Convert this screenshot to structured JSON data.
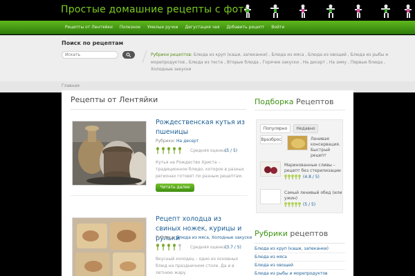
{
  "header": {
    "site_title": "Простые домашние рецепты с фото"
  },
  "nav": {
    "items": [
      "Рецепты от Лентяйки",
      "Полезное",
      "Умелые ручки",
      "Дегустация чая",
      "Добавить рецепт",
      "Войти"
    ]
  },
  "search": {
    "title": "Поиск по рецептам",
    "placeholder": "Искать",
    "button_icon": "search-icon"
  },
  "rubrics_strip": {
    "label": "Рубрики рецептов:",
    "text": " Блюда из круп (каши, запеканки) , Блюда из мяса , Блюда из овощей , Блюда из рыбы и морепродуктов , Блюда из теста , Вторые блюда , Горячие закуски , На десерт , На зиму , Первые блюда , Холодные закуски"
  },
  "breadcrumb": {
    "home": "Главная"
  },
  "main": {
    "title": "Рецепты от Лентяйки",
    "posts": [
      {
        "title": "Рождественская кутья из пшеницы",
        "category_label": "Рубрики:",
        "category": "На десерт",
        "rating_label": "Средняя оценка:",
        "rating_value": "(5 / 5)",
        "rating": 5,
        "excerpt": "Кутья на Рождество Христа – традиционное блюдо, которое в разных регионах готовят по разным рецептам. ...",
        "read_more": "Читать далее"
      },
      {
        "title": "Рецепт холодца из свиных ножек, курицы и рульки",
        "category_label": "Рубрики:",
        "category": "Блюда из мяса, Холодные закуски",
        "rating_label": "Средняя оценка:",
        "rating_value": "(3.7 / 5)",
        "rating": 3.7,
        "excerpt": "Вкусный холодец – одно из основных блюд на праздничном столе. Да и в летнюю жару"
      }
    ]
  },
  "sidebar": {
    "picks_title_accent": "Подборка",
    "picks_title_rest": " Рецептов",
    "tabs": [
      "Популярно",
      "Недавно",
      "Вразброс"
    ],
    "items": [
      {
        "title": "Ленивая консервация. Быстрый рецепт",
        "rating_value": ""
      },
      {
        "title": "Маринованные сливы – рецепт без стерилизации",
        "rating_value": "(4.8 / 5)"
      },
      {
        "title": "Самый ленивый обед (или ужин)",
        "rating_value": "(5 / 5)"
      }
    ],
    "rubrics_title_accent": "Рубрики",
    "rubrics_title_rest": " рецептов",
    "rubrics": [
      "Блюда из круп (каши, запеканки)",
      "Блюда из мяса",
      "Блюда из овощей",
      "Блюда из рыбы и морепродуктов"
    ]
  },
  "colors": {
    "accent_green": "#3e9115",
    "link_blue": "#1c5e94",
    "nav_green": "#4a9d17"
  }
}
